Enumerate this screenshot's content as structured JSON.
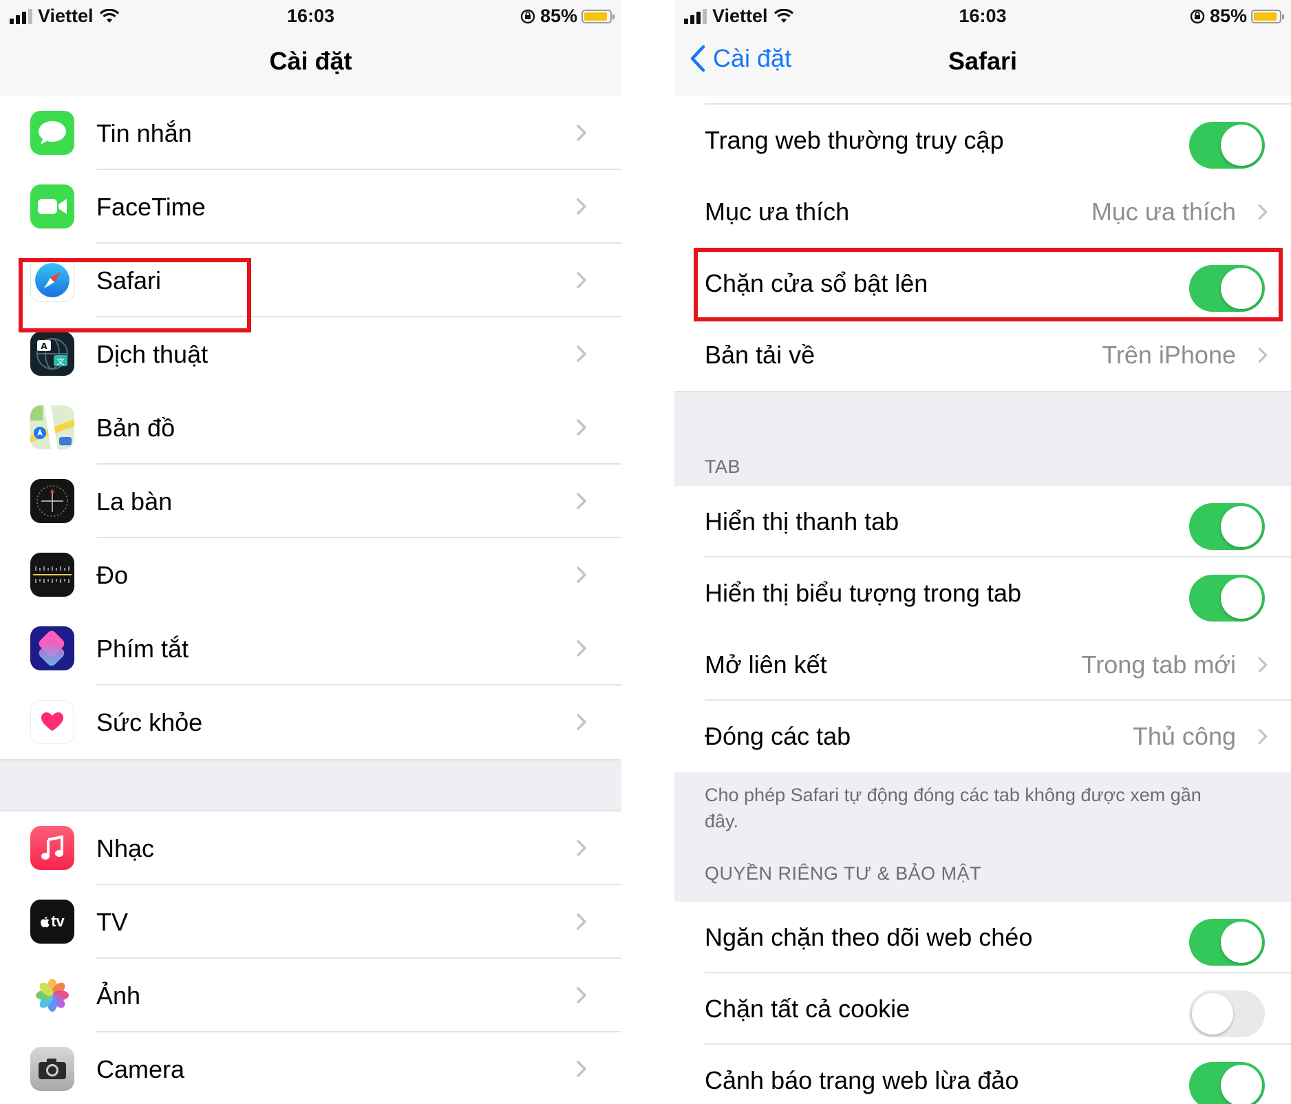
{
  "left": {
    "status": {
      "carrier": "Viettel",
      "time": "16:03",
      "battery": "85%"
    },
    "title": "Cài đặt",
    "group1": [
      {
        "label": "Tin nhắn",
        "icon": "messages-icon"
      },
      {
        "label": "FaceTime",
        "icon": "facetime-icon"
      },
      {
        "label": "Safari",
        "icon": "safari-icon",
        "highlighted": true
      },
      {
        "label": "Dịch thuật",
        "icon": "translate-icon"
      },
      {
        "label": "Bản đồ",
        "icon": "maps-icon"
      },
      {
        "label": "La bàn",
        "icon": "compass-icon"
      },
      {
        "label": "Đo",
        "icon": "measure-icon"
      },
      {
        "label": "Phím tắt",
        "icon": "shortcuts-icon"
      },
      {
        "label": "Sức khỏe",
        "icon": "health-icon"
      }
    ],
    "group2": [
      {
        "label": "Nhạc",
        "icon": "music-icon"
      },
      {
        "label": "TV",
        "icon": "tv-icon",
        "icon_text": "tv"
      },
      {
        "label": "Ảnh",
        "icon": "photos-icon"
      },
      {
        "label": "Camera",
        "icon": "camera-icon"
      }
    ]
  },
  "right": {
    "status": {
      "carrier": "Viettel",
      "time": "16:03",
      "battery": "85%"
    },
    "back_label": "Cài đặt",
    "title": "Safari",
    "rows_general": [
      {
        "label": "Trang web thường truy cập",
        "toggle": true
      },
      {
        "label": "Mục ưa thích",
        "value": "Mục ưa thích"
      },
      {
        "label": "Chặn cửa sổ bật lên",
        "toggle": true,
        "highlighted": true
      },
      {
        "label": "Bản tải về",
        "value": "Trên iPhone"
      }
    ],
    "tab_section": "TAB",
    "rows_tab": [
      {
        "label": "Hiển thị thanh tab",
        "toggle": true
      },
      {
        "label": "Hiển thị biểu tượng trong tab",
        "toggle": true
      },
      {
        "label": "Mở liên kết",
        "value": "Trong tab mới"
      },
      {
        "label": "Đóng các tab",
        "value": "Thủ công"
      }
    ],
    "tab_footnote": "Cho phép Safari tự động đóng các tab không được xem gần đây.",
    "privacy_section": "QUYỀN RIÊNG TƯ & BẢO MẬT",
    "rows_privacy": [
      {
        "label": "Ngăn chặn theo dõi web chéo",
        "toggle": true
      },
      {
        "label": "Chặn tất cả cookie",
        "toggle": false
      },
      {
        "label": "Cảnh báo trang web lừa đảo",
        "toggle": true
      }
    ]
  },
  "colors": {
    "toggle_on": "#34c759",
    "link_blue": "#1478f5",
    "highlight": "#e4141c"
  }
}
